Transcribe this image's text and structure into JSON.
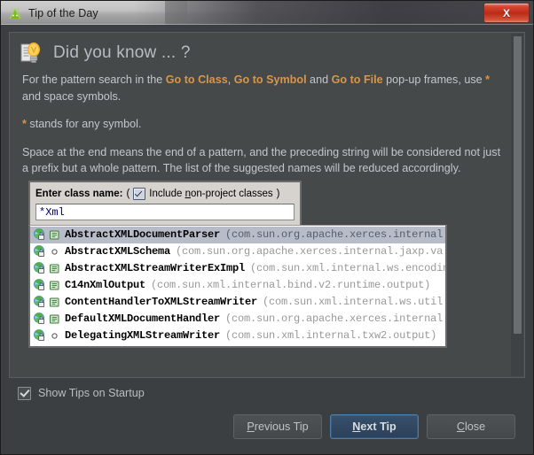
{
  "window": {
    "title": "Tip of the Day",
    "app_icon": "android-studio-icon",
    "close_label": "X"
  },
  "tip": {
    "icon": "lightbulb-icon",
    "heading": "Did you know ... ?",
    "paragraphs": {
      "p1_a": "For the pattern search in the ",
      "p1_kw1": "Go to Class",
      "p1_b": ", ",
      "p1_kw2": "Go to Symbol",
      "p1_c": " and ",
      "p1_kw3": "Go to File",
      "p1_d": " pop-up frames, use ",
      "p1_star": "*",
      "p1_e": " and space symbols.",
      "p2_star": "*",
      "p2_text": " stands for any symbol.",
      "p3": "Space at the end means the end of a pattern, and the preceding string will be considered not just a prefix but a whole pattern. The list of the suggested names will be reduced accordingly."
    }
  },
  "screenshot": {
    "search_label": "Enter class name:",
    "paren_open": "(",
    "paren_close": ")",
    "checkbox_label_pre": "Include ",
    "checkbox_label_mn": "n",
    "checkbox_label_post": "on-project classes",
    "checkbox_checked": true,
    "input_value": "*Xml",
    "results": [
      {
        "icon": "class-locked-icon",
        "modifier_icon": "final-marker-icon",
        "name": "AbstractXMLDocumentParser",
        "package": "(com.sun.org.apache.xerces.internal",
        "selected": true
      },
      {
        "icon": "class-locked-icon",
        "modifier_icon": "abstract-marker-icon",
        "name": "AbstractXMLSchema",
        "package": "(com.sun.org.apache.xerces.internal.jaxp.va",
        "selected": false
      },
      {
        "icon": "class-locked-icon",
        "modifier_icon": "final-marker-icon",
        "name": "AbstractXMLStreamWriterExImpl",
        "package": "(com.sun.xml.internal.ws.encodin",
        "selected": false
      },
      {
        "icon": "class-locked-icon",
        "modifier_icon": "final-marker-icon",
        "name": "C14nXmlOutput",
        "package": "(com.sun.xml.internal.bind.v2.runtime.output)",
        "selected": false
      },
      {
        "icon": "class-locked-icon",
        "modifier_icon": "final-marker-icon",
        "name": "ContentHandlerToXMLStreamWriter",
        "package": "(com.sun.xml.internal.ws.util",
        "selected": false
      },
      {
        "icon": "class-locked-icon",
        "modifier_icon": "final-marker-icon",
        "name": "DefaultXMLDocumentHandler",
        "package": "(com.sun.org.apache.xerces.internal",
        "selected": false
      },
      {
        "icon": "class-locked-icon",
        "modifier_icon": "abstract-marker-icon",
        "name": "DelegatingXMLStreamWriter",
        "package": "(com.sun.xml.internal.txw2.output)",
        "selected": false
      }
    ]
  },
  "footer": {
    "show_tips_label": "Show Tips on Startup",
    "show_tips_checked": true,
    "buttons": {
      "previous": {
        "mnemonic": "P",
        "rest": "revious Tip"
      },
      "next": {
        "mnemonic": "N",
        "rest": "ext Tip",
        "is_default": true
      },
      "close": {
        "mnemonic": "C",
        "rest": "lose"
      }
    }
  },
  "colors": {
    "dialog_bg": "#3c3f41",
    "panel_bg": "#45494a",
    "accent_orange": "#d99646",
    "text": "#c3c7cb",
    "default_button_blue": "#2c4059",
    "close_red": "#bb2a18"
  }
}
